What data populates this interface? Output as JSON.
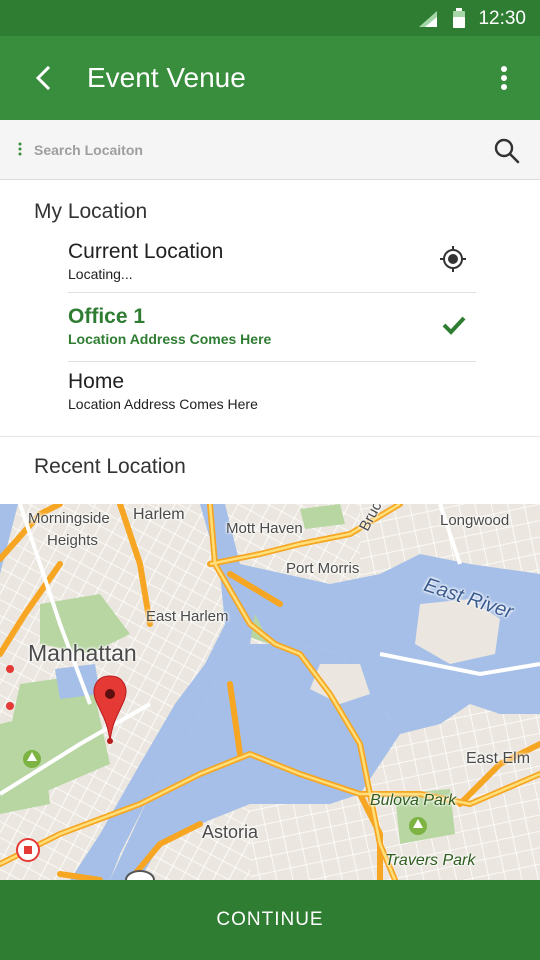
{
  "status_bar": {
    "time": "12:30"
  },
  "app_bar": {
    "title": "Event Venue"
  },
  "search": {
    "placeholder": "Search Locaiton"
  },
  "my_location": {
    "heading": "My Location",
    "items": [
      {
        "name": "Current Location",
        "subtitle": "Locating...",
        "icon": "gps-target-icon",
        "selected": false
      },
      {
        "name": "Office 1",
        "subtitle": "Location Address Comes Here",
        "icon": "check-icon",
        "selected": true
      },
      {
        "name": "Home",
        "subtitle": "Location Address Comes Here",
        "icon": "",
        "selected": false
      }
    ]
  },
  "recent_location": {
    "heading": "Recent Location"
  },
  "map": {
    "labels": {
      "morningside": "Morningside",
      "heights": "Heights",
      "harlem": "Harlem",
      "mott_haven": "Mott Haven",
      "bruckner": "Bruc",
      "longwood": "Longwood",
      "port_morris": "Port Morris",
      "east_river": "East River",
      "east_harlem": "East Harlem",
      "manhattan": "Manhattan",
      "east_elm": "East Elm",
      "bulova_park": "Bulova Park",
      "astoria": "Astoria",
      "travers_park": "Travers Park"
    }
  },
  "colors": {
    "primary": "#388e3c",
    "primary_dark": "#2e7d32",
    "accent": "#2e7d32"
  },
  "footer": {
    "continue_label": "CONTINUE"
  }
}
